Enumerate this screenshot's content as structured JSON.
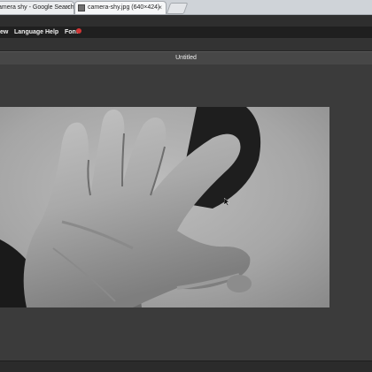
{
  "browser": {
    "tabs": [
      {
        "label": "amera shy - Google Search",
        "close": "×"
      },
      {
        "label": "camera-shy.jpg (640×424)",
        "close": "×"
      }
    ]
  },
  "menubar": {
    "items": [
      "ew",
      "Language",
      "Help",
      "Font"
    ]
  },
  "document": {
    "title": "Untitled"
  },
  "colors": {
    "menubar": "#1f1f1f",
    "canvas": "#3b3b3b",
    "badge": "#d23535"
  }
}
